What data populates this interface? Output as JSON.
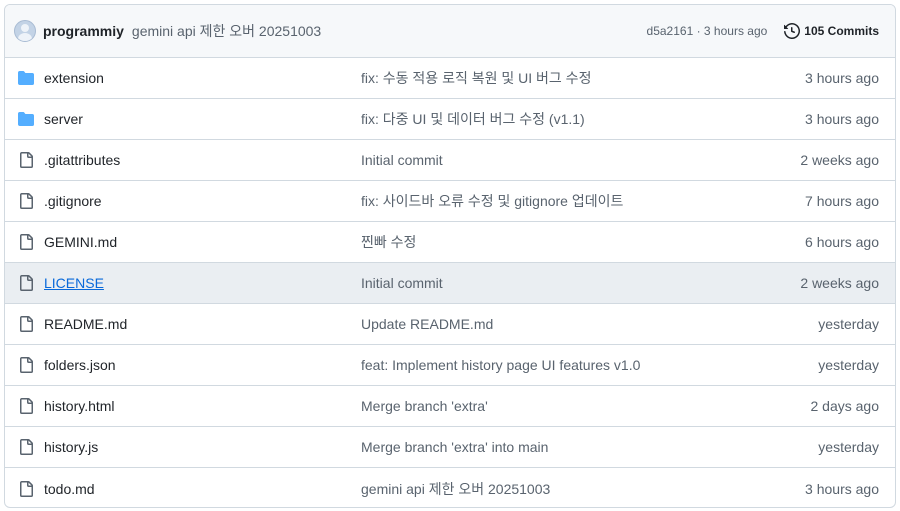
{
  "latest_commit": {
    "author": "programmiy",
    "message": "gemini api 제한 오버 20251003",
    "hash_time": "d5a2161 · 3 hours ago",
    "commits_label": "105 Commits"
  },
  "files": [
    {
      "name": "extension",
      "type": "folder",
      "message": "fix: 수동 적용 로직 복원 및 UI 버그 수정",
      "age": "3 hours ago"
    },
    {
      "name": "server",
      "type": "folder",
      "message": "fix: 다중 UI 및 데이터 버그 수정 (v1.1)",
      "age": "3 hours ago"
    },
    {
      "name": ".gitattributes",
      "type": "file",
      "message": "Initial commit",
      "age": "2 weeks ago"
    },
    {
      "name": ".gitignore",
      "type": "file",
      "message": "fix: 사이드바 오류 수정 및 gitignore 업데이트",
      "age": "7 hours ago"
    },
    {
      "name": "GEMINI.md",
      "type": "file",
      "message": "찐빠 수정",
      "age": "6 hours ago"
    },
    {
      "name": "LICENSE",
      "type": "file",
      "message": "Initial commit",
      "age": "2 weeks ago"
    },
    {
      "name": "README.md",
      "type": "file",
      "message": "Update README.md",
      "age": "yesterday"
    },
    {
      "name": "folders.json",
      "type": "file",
      "message": "feat: Implement history page UI features v1.0",
      "age": "yesterday"
    },
    {
      "name": "history.html",
      "type": "file",
      "message": "Merge branch 'extra'",
      "age": "2 days ago"
    },
    {
      "name": "history.js",
      "type": "file",
      "message": "Merge branch 'extra' into main",
      "age": "yesterday"
    },
    {
      "name": "todo.md",
      "type": "file",
      "message": "gemini api 제한 오버 20251003",
      "age": "3 hours ago"
    }
  ],
  "colors": {
    "folder": "#54aeff",
    "link": "#0969da",
    "muted": "#59636e"
  }
}
